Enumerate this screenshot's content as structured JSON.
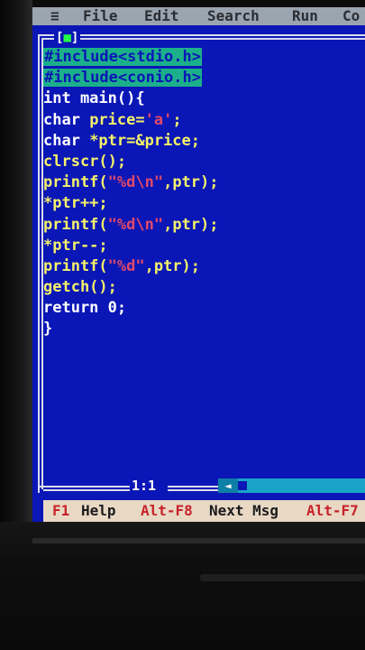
{
  "menu": {
    "system": "≡",
    "items": [
      "File",
      "Edit",
      "Search",
      "Run",
      "Co"
    ]
  },
  "window": {
    "close_box_left": "[",
    "close_box_mark": "■",
    "close_box_right": "]",
    "cursor_position": "1:1",
    "scroll_arrow": "◄"
  },
  "code": {
    "line1": "#include<stdio.h>",
    "line2": "#include<conio.h>",
    "line3": "int main(){",
    "line4_kw": "char ",
    "line4_a": "price=",
    "line4_str": "'a'",
    "line4_b": ";",
    "line5_kw": "char ",
    "line5_a": "*ptr=&price;",
    "line6": "clrscr();",
    "line7_fn": "printf(",
    "line7_str": "\"%d\\n\"",
    "line7_b": ",ptr);",
    "line8": "*ptr++;",
    "line9_fn": "printf(",
    "line9_str": "\"%d\\n\"",
    "line9_b": ",ptr);",
    "line10": "*ptr--;",
    "line11_fn": "printf(",
    "line11_str": "\"%d\"",
    "line11_b": ",ptr);",
    "line12": "getch();",
    "line13": "return 0;",
    "line14": "}"
  },
  "status": {
    "key1": "F1",
    "label1": "Help",
    "key2": "Alt-F8",
    "label2": "Next Msg",
    "key3": "Alt-F7"
  },
  "colors": {
    "editor_bg": "#0b16b6",
    "menu_bg": "#9aa5b0",
    "status_bg": "#e8d8c4",
    "preprocessor_bg": "#1bb08a",
    "string": "#e04a6a",
    "function": "#f4f26a"
  }
}
